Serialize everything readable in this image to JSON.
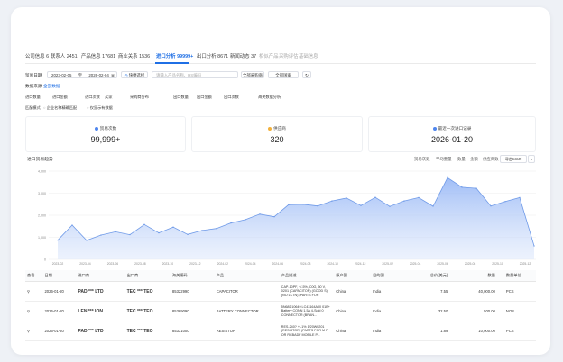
{
  "tabs": [
    {
      "label": "公司信息",
      "count": "6"
    },
    {
      "label": "联系人",
      "count": "2451"
    },
    {
      "label": "产品信息",
      "count": "17681"
    },
    {
      "label": "商业关系",
      "count": "1536"
    },
    {
      "label": "进口分析",
      "count": "99999+"
    },
    {
      "label": "出口分析",
      "count": "8671"
    },
    {
      "label": "新闻动态",
      "count": "37"
    },
    {
      "label": "相似产品",
      "count": ""
    },
    {
      "label": "采购评估",
      "count": ""
    },
    {
      "label": "基础信息",
      "count": ""
    }
  ],
  "filters": {
    "date_label": "贸易日期",
    "date_start": "2023-02-05",
    "date_sep": "至",
    "date_end": "2026-02-04",
    "quick_btn": "快捷选择",
    "product_placeholder": "请输入产品名称、HS编码",
    "all_partner": "全部采购商",
    "all_ports": "全部国家",
    "reset": "",
    "data_source_label": "数据来源",
    "data_source_value": "全部数据",
    "row3": [
      "进口数量",
      "进口金额",
      "进口次数",
      "买家",
      "采购商分布",
      "出口数量",
      "出口金额",
      "出口次数",
      "海关数据分析"
    ],
    "compare_label": "匹配模式",
    "opt1": "企业名称精确匹配",
    "opt2": "仅显示有数据"
  },
  "stats": [
    {
      "title": "贸易次数",
      "value": "99,999+",
      "color": "#4f86ee"
    },
    {
      "title": "供应商",
      "value": "320",
      "color": "#f2b13c"
    },
    {
      "title": "最近一次进口记录",
      "value": "2026-01-20",
      "color": "#4f86ee"
    }
  ],
  "chart_section": {
    "title": "进口贸易趋势",
    "controls": [
      "贸易次数",
      "平均重量",
      "数量",
      "金额",
      "供应商数"
    ],
    "export": "导出Excel"
  },
  "chart_data": {
    "type": "area",
    "title": "",
    "x": [
      "2023-02",
      "2023-04",
      "2023-06",
      "2023-08",
      "2023-10",
      "2023-12",
      "2024-02",
      "2024-04",
      "2024-06",
      "2024-08",
      "2024-10",
      "2024-12",
      "2025-02",
      "2025-04",
      "2025-06",
      "2025-08",
      "2025-10",
      "2025-12"
    ],
    "values": [
      870,
      1550,
      860,
      1100,
      1250,
      1120,
      1580,
      1200,
      1460,
      1130,
      1310,
      1400,
      1650,
      1800,
      2050,
      1930,
      2480,
      2500,
      2420,
      2650,
      2780,
      2440,
      2810,
      2400,
      2650,
      2800,
      2410,
      3700,
      3270,
      3220,
      2420,
      2620,
      2800,
      610
    ],
    "y_ticks": [
      "0",
      "1,000",
      "2,000",
      "3,000",
      "4,000"
    ],
    "ylim": [
      0,
      4000
    ]
  },
  "table": {
    "columns": [
      "查看",
      "日期",
      "进口商",
      "出口商",
      "海关编码",
      "产品",
      "产品描述",
      "原产国",
      "目的国",
      "总价(美元)",
      "数量",
      "数量单位"
    ],
    "view_icon": "link-icon",
    "rows": [
      {
        "date": "2026-01-20",
        "importer": "PAD *** LTD",
        "exporter": "TEC *** TEO",
        "hs": "85322990",
        "product": "CAPACITOR",
        "desc": "CAP-10PF, +/-5%, C0G, 50 V, 0201 (CAPACITOR) (GOOD S) (NO LCTN) (PARTS FOR",
        "origin": "China",
        "dest": "India",
        "total": "7.55",
        "qty": "40,000.00",
        "unit": "PCS"
      },
      {
        "date": "2026-01-20",
        "importer": "LEN *** ION",
        "exporter": "TEC *** TEO",
        "hs": "85369090",
        "product": "BATTERY CONNECTOR",
        "desc": "5N68D10649 LC43164A00 01B+ Battery CONN 1.5A 4-Sold 0 CONNECTOR (BRAN...",
        "origin": "China",
        "dest": "India",
        "total": "32.50",
        "qty": "500.00",
        "unit": "NOS"
      },
      {
        "date": "2026-01-20",
        "importer": "PAD *** LTD",
        "exporter": "TEC *** TEO",
        "hs": "85331000",
        "product": "RESISTOR",
        "desc": "RES-240? +/-1% 1/20W0201 (RESISTOR) (PARTS FOR M F OR RCBADF MOBILE P...",
        "origin": "China",
        "dest": "India",
        "total": "1.89",
        "qty": "10,000.00",
        "unit": "PCS"
      }
    ]
  }
}
